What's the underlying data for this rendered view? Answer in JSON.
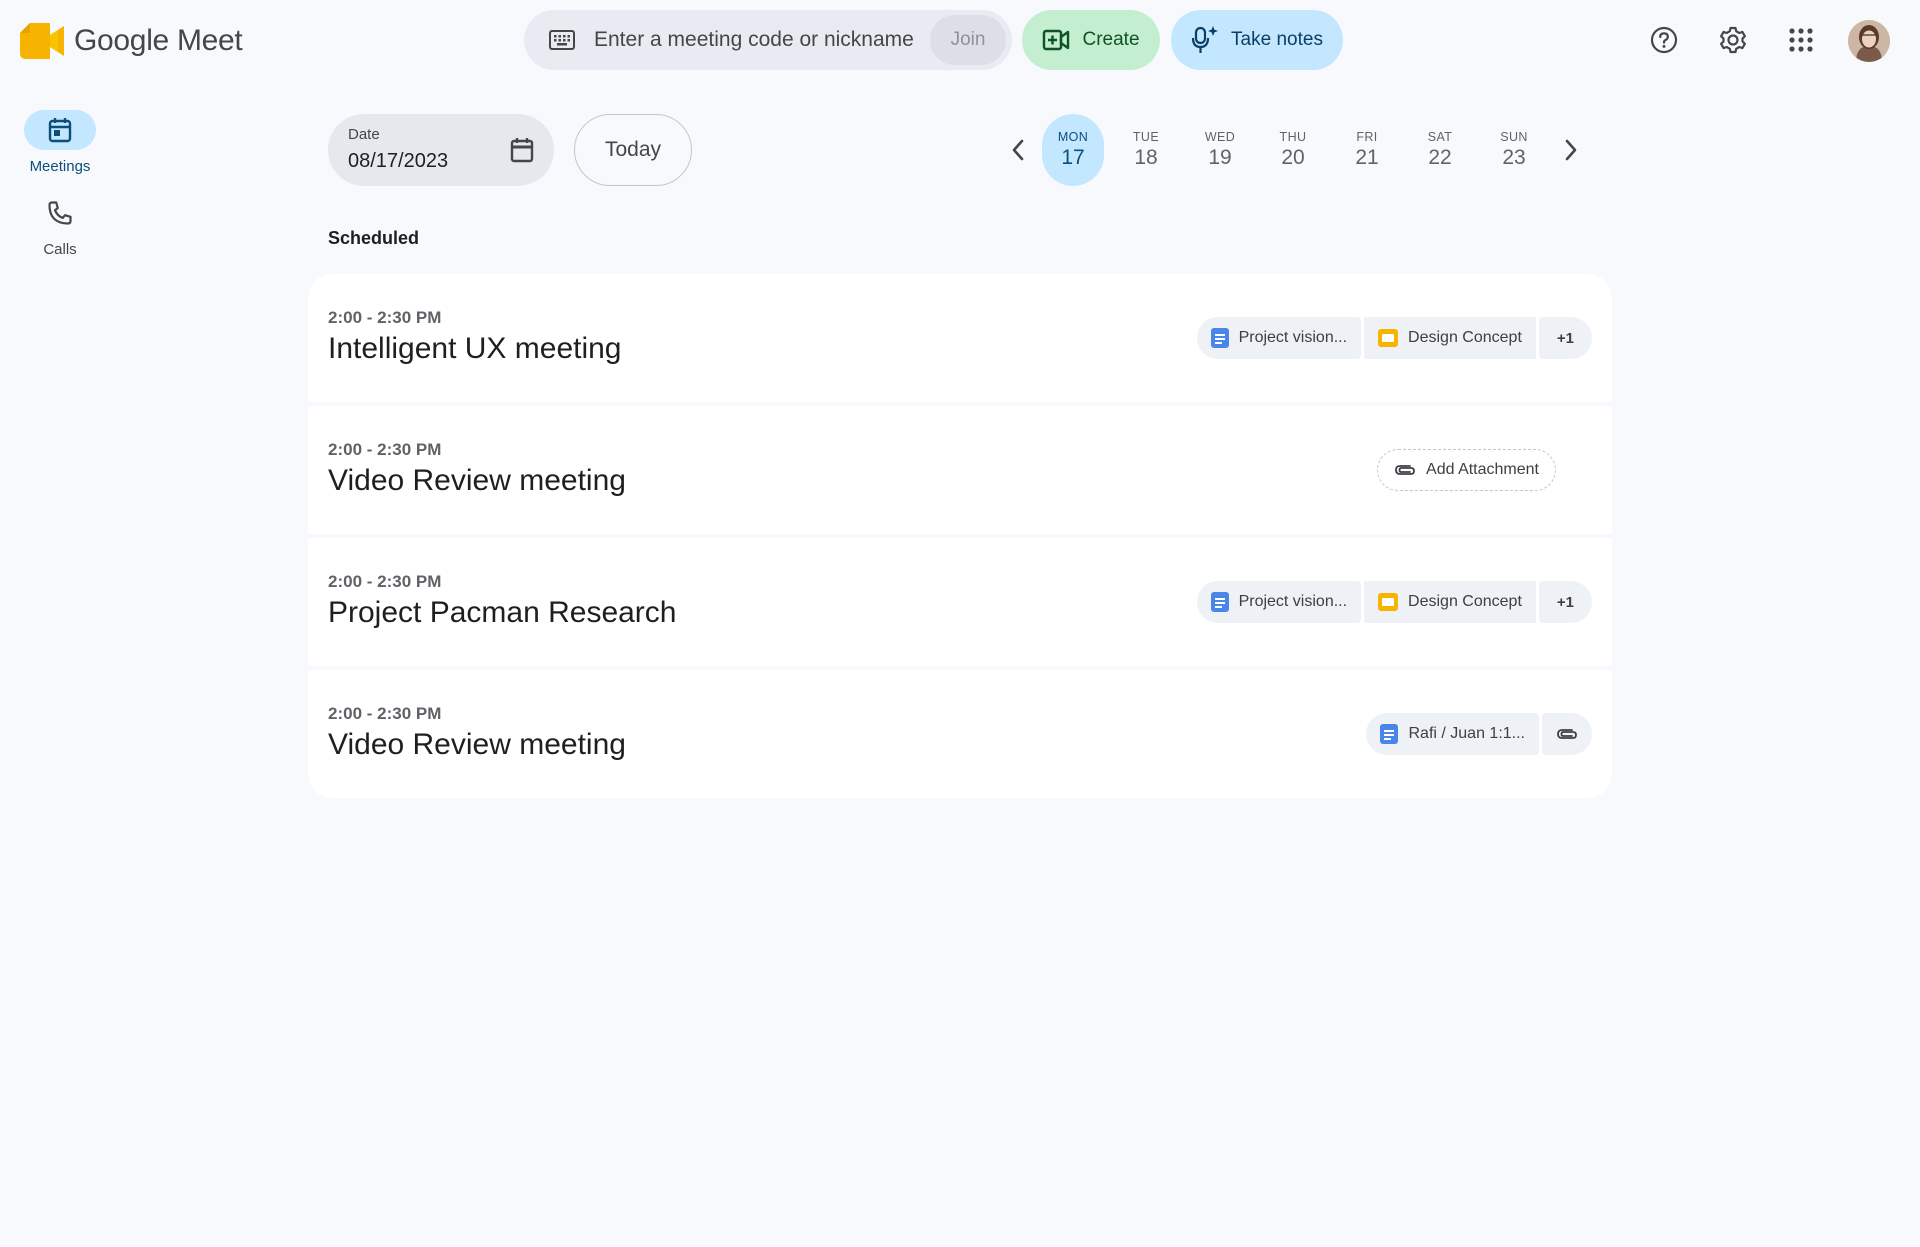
{
  "app": {
    "name": "Google Meet"
  },
  "topbar": {
    "join_placeholder": "Enter a meeting code or nickname",
    "join_label": "Join",
    "create_label": "Create",
    "notes_label": "Take notes"
  },
  "sidenav": {
    "items": [
      {
        "label": "Meetings",
        "icon": "calendar-icon",
        "active": true
      },
      {
        "label": "Calls",
        "icon": "phone-icon",
        "active": false
      }
    ]
  },
  "date_picker": {
    "label": "Date",
    "value": "08/17/2023",
    "today_label": "Today"
  },
  "week": {
    "days": [
      {
        "name": "MON",
        "num": "17",
        "active": true
      },
      {
        "name": "TUE",
        "num": "18"
      },
      {
        "name": "WED",
        "num": "19"
      },
      {
        "name": "THU",
        "num": "20"
      },
      {
        "name": "FRI",
        "num": "21"
      },
      {
        "name": "SAT",
        "num": "22"
      },
      {
        "name": "SUN",
        "num": "23"
      }
    ]
  },
  "scheduled": {
    "title": "Scheduled",
    "meetings": [
      {
        "time": "2:00 - 2:30 PM",
        "title": "Intelligent UX meeting",
        "chips": [
          "Project vision...",
          "Design Concept",
          "+1"
        ]
      },
      {
        "time": "2:00 - 2:30 PM",
        "title": "Video Review meeting",
        "add_attachment": "Add Attachment"
      },
      {
        "time": "2:00 - 2:30 PM",
        "title": "Project Pacman Research",
        "chips": [
          "Project vision...",
          "Design Concept",
          "+1"
        ]
      },
      {
        "time": "2:00 - 2:30 PM",
        "title": "Video Review meeting",
        "chips": [
          "Rafi / Juan 1:1..."
        ]
      }
    ]
  },
  "colors": {
    "accent": "#c2e7ff",
    "create": "#c4eed0",
    "background": "#f8f9fd"
  }
}
